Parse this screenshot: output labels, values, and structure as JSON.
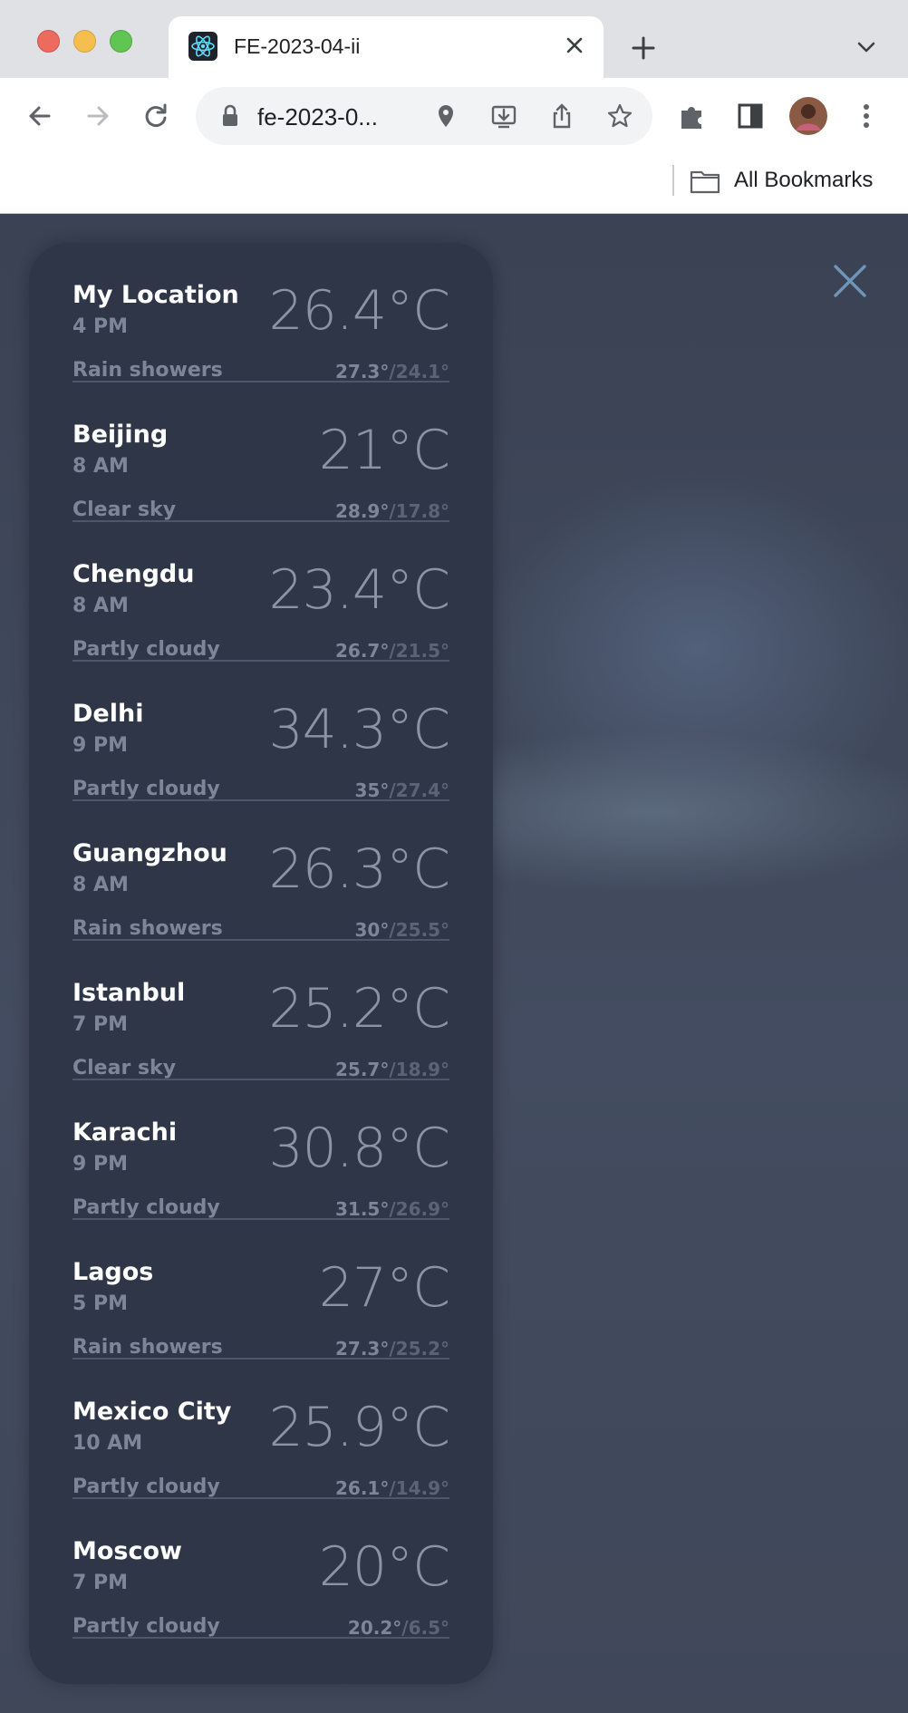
{
  "browser": {
    "tab_title": "FE-2023-04-ii",
    "address": "fe-2023-0...",
    "bookmarks_label": "All Bookmarks"
  },
  "cities": [
    {
      "name": "My Location",
      "time": "4 PM",
      "temp": "26.4°C",
      "condition": "Rain showers",
      "high": "27.3°",
      "low": "/24.1°"
    },
    {
      "name": "Beijing",
      "time": "8 AM",
      "temp": "21°C",
      "condition": "Clear sky",
      "high": "28.9°",
      "low": "/17.8°"
    },
    {
      "name": "Chengdu",
      "time": "8 AM",
      "temp": "23.4°C",
      "condition": "Partly cloudy",
      "high": "26.7°",
      "low": "/21.5°"
    },
    {
      "name": "Delhi",
      "time": "9 PM",
      "temp": "34.3°C",
      "condition": "Partly cloudy",
      "high": "35°",
      "low": "/27.4°"
    },
    {
      "name": "Guangzhou",
      "time": "8 AM",
      "temp": "26.3°C",
      "condition": "Rain showers",
      "high": "30°",
      "low": "/25.5°"
    },
    {
      "name": "Istanbul",
      "time": "7 PM",
      "temp": "25.2°C",
      "condition": "Clear sky",
      "high": "25.7°",
      "low": "/18.9°"
    },
    {
      "name": "Karachi",
      "time": "9 PM",
      "temp": "30.8°C",
      "condition": "Partly cloudy",
      "high": "31.5°",
      "low": "/26.9°"
    },
    {
      "name": "Lagos",
      "time": "5 PM",
      "temp": "27°C",
      "condition": "Rain showers",
      "high": "27.3°",
      "low": "/25.2°"
    },
    {
      "name": "Mexico City",
      "time": "10 AM",
      "temp": "25.9°C",
      "condition": "Partly cloudy",
      "high": "26.1°",
      "low": "/14.9°"
    },
    {
      "name": "Moscow",
      "time": "7 PM",
      "temp": "20°C",
      "condition": "Partly cloudy",
      "high": "20.2°",
      "low": "/6.5°"
    }
  ],
  "colors": {
    "panel_bg": "#2f3647",
    "page_bg": "#3e4657",
    "close_accent": "#6f95b8"
  }
}
